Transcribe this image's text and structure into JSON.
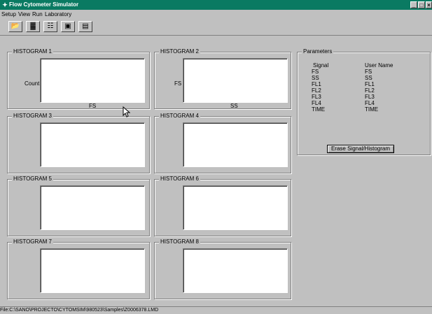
{
  "window": {
    "title": "Flow Cytometer Simulator"
  },
  "menu": [
    "Setup",
    "View",
    "Run",
    "Laboratory"
  ],
  "toolbar": {
    "icons": [
      "open-file-icon",
      "histogram-icon",
      "dot-plot-icon",
      "run-icon",
      "laboratory-icon"
    ]
  },
  "histograms": [
    {
      "label": "HISTOGRAM 1",
      "y_label": "Count",
      "x_label": "FS"
    },
    {
      "label": "HISTOGRAM 2",
      "y_label": "FS",
      "x_label": "SS"
    },
    {
      "label": "HISTOGRAM 3",
      "y_label": "",
      "x_label": ""
    },
    {
      "label": "HISTOGRAM 4",
      "y_label": "",
      "x_label": ""
    },
    {
      "label": "HISTOGRAM 5",
      "y_label": "",
      "x_label": ""
    },
    {
      "label": "HISTOGRAM 6",
      "y_label": "",
      "x_label": ""
    },
    {
      "label": "HISTOGRAM 7",
      "y_label": "",
      "x_label": ""
    },
    {
      "label": "HISTOGRAM 8",
      "y_label": "",
      "x_label": ""
    }
  ],
  "parameters": {
    "title": "Parameters",
    "signal_header": "Signal",
    "username_header": "User Name",
    "signals": [
      "FS",
      "SS",
      "FL1",
      "FL2",
      "FL3",
      "FL4",
      "TIME"
    ],
    "user_names": [
      "FS",
      "SS",
      "FL1",
      "FL2",
      "FL3",
      "FL4",
      "TIME"
    ],
    "erase_button": "Erase Signal/Histogram"
  },
  "status": {
    "file": "File:C:\\SANO\\PROJECTO\\CYTOMSIM\\980523\\Samples\\Z0006378.LMD"
  }
}
